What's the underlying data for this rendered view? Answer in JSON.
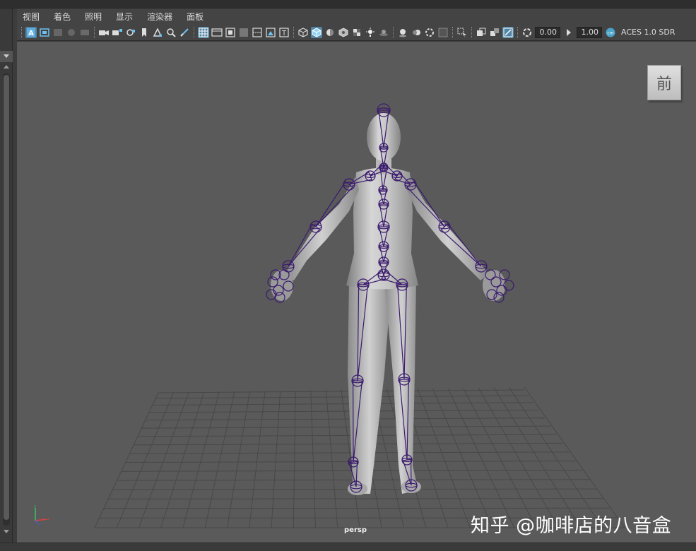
{
  "menubar": {
    "items": [
      "视图",
      "着色",
      "照明",
      "显示",
      "渲染器",
      "面板"
    ]
  },
  "toolbar": {
    "exposure_value": "0.00",
    "gamma_value": "1.00",
    "colorspace_label": "ACES 1.0 SDR"
  },
  "viewport": {
    "camera_name": "persp",
    "view_cube_face": "前"
  },
  "watermark": {
    "text": "知乎 @咖啡店的八音盒"
  },
  "colors": {
    "viewport_bg": "#5a5a5a",
    "grid_line": "#4a4a4a",
    "joint_color": "#3a1a6e",
    "mesh_light": "#cfcfcf",
    "mesh_dark": "#8a8a8a",
    "active_icon": "#5285a6"
  }
}
